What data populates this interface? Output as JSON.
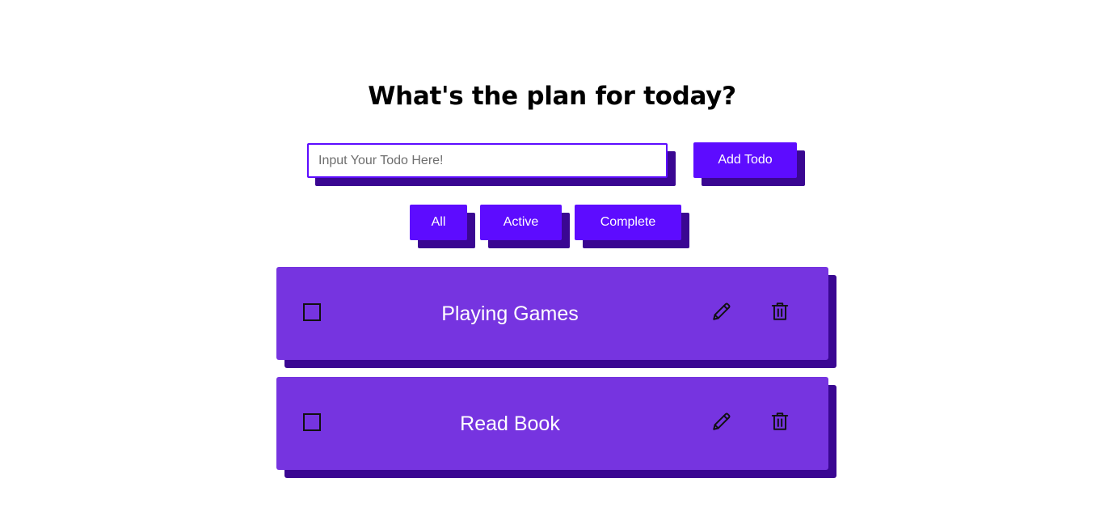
{
  "header": {
    "title": "What's the plan for today?"
  },
  "form": {
    "input_placeholder": "Input Your Todo Here!",
    "input_value": "",
    "add_label": "Add Todo"
  },
  "filters": {
    "all_label": "All",
    "active_label": "Active",
    "complete_label": "Complete"
  },
  "todos": [
    {
      "text": "Playing Games",
      "completed": false,
      "edit_icon": "pencil-icon",
      "delete_icon": "trash-icon"
    },
    {
      "text": "Read Book",
      "completed": false,
      "edit_icon": "pencil-icon",
      "delete_icon": "trash-icon"
    }
  ],
  "colors": {
    "accent": "#5d0cff",
    "shadow": "#3a0792",
    "card": "#7634e0",
    "text_light": "#ffffff"
  }
}
